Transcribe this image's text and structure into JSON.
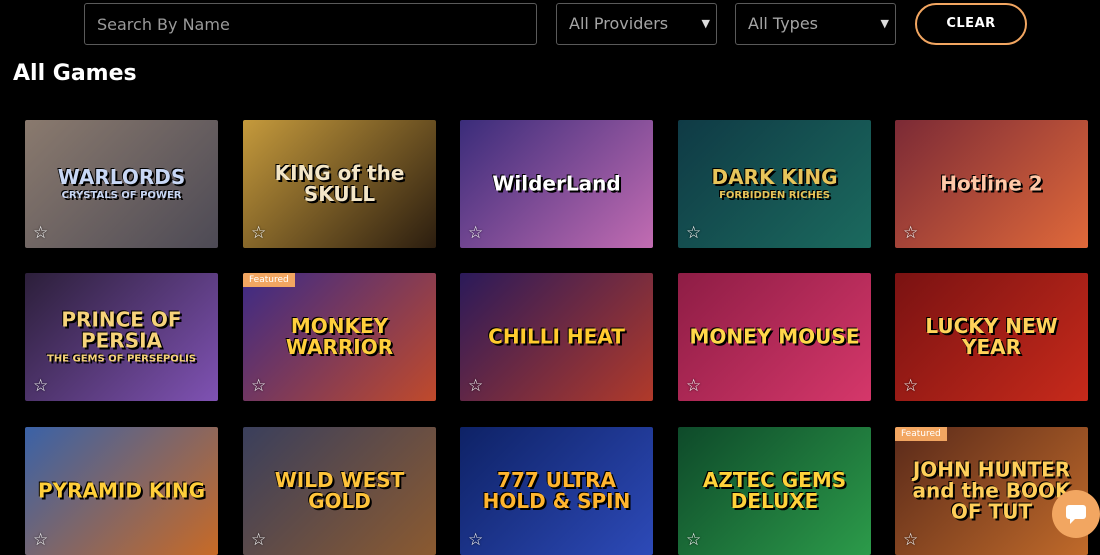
{
  "filters": {
    "search_placeholder": "Search By Name",
    "providers_value": "All Providers",
    "types_value": "All Types",
    "clear_label": "CLEAR"
  },
  "section_title": "All Games",
  "games": [
    {
      "title": "WARLORDS",
      "subtitle": "CRYSTALS OF POWER",
      "featured": false,
      "colors": [
        "#8a7a6e",
        "#4d4a55"
      ],
      "text_color": "#c8d7f5"
    },
    {
      "title": "KING of the SKULL",
      "subtitle": "",
      "featured": false,
      "colors": [
        "#c59a3c",
        "#2b1d0f"
      ],
      "text_color": "#f3e6c8"
    },
    {
      "title": "WilderLand",
      "subtitle": "",
      "featured": false,
      "colors": [
        "#3a2c7a",
        "#c26cb2"
      ],
      "text_color": "#ffffff"
    },
    {
      "title": "DARK KING",
      "subtitle": "FORBIDDEN RICHES",
      "featured": false,
      "colors": [
        "#0f3a45",
        "#1b6a5e"
      ],
      "text_color": "#e7c45a"
    },
    {
      "title": "Hotline 2",
      "subtitle": "",
      "featured": false,
      "colors": [
        "#7b2a36",
        "#e0693a"
      ],
      "text_color": "#ffc9a8"
    },
    {
      "title": "PRINCE OF PERSIA",
      "subtitle": "THE GEMS OF PERSEPOLIS",
      "featured": false,
      "colors": [
        "#2c1f3a",
        "#7f52b3"
      ],
      "text_color": "#f6d37a"
    },
    {
      "title": "MONKEY WARRIOR",
      "subtitle": "",
      "featured": true,
      "featured_label": "Featured",
      "colors": [
        "#3c2a86",
        "#c04a2b"
      ],
      "text_color": "#ffcf3c"
    },
    {
      "title": "CHILLI HEAT",
      "subtitle": "",
      "featured": false,
      "colors": [
        "#2b1a5a",
        "#b13a2a"
      ],
      "text_color": "#ffcb2e"
    },
    {
      "title": "MONEY MOUSE",
      "subtitle": "",
      "featured": false,
      "colors": [
        "#8e1d45",
        "#d5376a"
      ],
      "text_color": "#ffd84a"
    },
    {
      "title": "LUCKY NEW YEAR",
      "subtitle": "",
      "featured": false,
      "colors": [
        "#7a1212",
        "#c72a1b"
      ],
      "text_color": "#ffd35a"
    },
    {
      "title": "PYRAMID KING",
      "subtitle": "",
      "featured": false,
      "colors": [
        "#3a62a7",
        "#c86a26"
      ],
      "text_color": "#ffcf3a"
    },
    {
      "title": "WILD WEST GOLD",
      "subtitle": "",
      "featured": false,
      "colors": [
        "#3a3f5c",
        "#8b5a30"
      ],
      "text_color": "#ffc43a"
    },
    {
      "title": "777 ULTRA HOLD & SPIN",
      "subtitle": "",
      "featured": false,
      "colors": [
        "#0e2266",
        "#2d4ab8"
      ],
      "text_color": "#ffb52e"
    },
    {
      "title": "AZTEC GEMS DELUXE",
      "subtitle": "",
      "featured": false,
      "colors": [
        "#0e4a2a",
        "#2c9b4a"
      ],
      "text_color": "#ffd23a"
    },
    {
      "title": "JOHN HUNTER and the BOOK OF TUT",
      "subtitle": "",
      "featured": true,
      "featured_label": "Featured",
      "colors": [
        "#5a2a1a",
        "#c06a2a"
      ],
      "text_color": "#ffcf5a"
    }
  ],
  "icons": {
    "favorite": "star-outline-icon",
    "chat": "chat-icon",
    "dropdown": "chevron-down-icon"
  },
  "accent_color": "#f2a661"
}
